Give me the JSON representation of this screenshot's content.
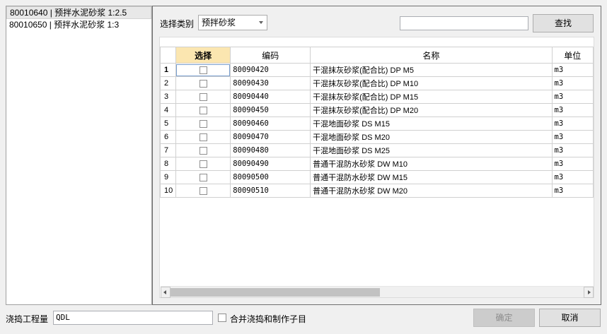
{
  "left_list": [
    {
      "label": "80010640 | 预拌水泥砂浆 1:2.5",
      "selected": true
    },
    {
      "label": "80010650 | 预拌水泥砂浆 1:3",
      "selected": false
    }
  ],
  "filter": {
    "category_label": "选择类别",
    "category_value": "预拌砂浆",
    "search_value": "",
    "search_button": "查找"
  },
  "table": {
    "headers": {
      "select": "选择",
      "code": "编码",
      "name": "名称",
      "unit": "单位"
    },
    "rows": [
      {
        "num": "1",
        "checked": false,
        "code": "80090420",
        "name": "干混抹灰砂浆(配合比) DP M5",
        "unit": "m3"
      },
      {
        "num": "2",
        "checked": false,
        "code": "80090430",
        "name": "干混抹灰砂浆(配合比) DP M10",
        "unit": "m3"
      },
      {
        "num": "3",
        "checked": false,
        "code": "80090440",
        "name": "干混抹灰砂浆(配合比) DP M15",
        "unit": "m3"
      },
      {
        "num": "4",
        "checked": false,
        "code": "80090450",
        "name": "干混抹灰砂浆(配合比) DP M20",
        "unit": "m3"
      },
      {
        "num": "5",
        "checked": false,
        "code": "80090460",
        "name": "干混地面砂浆 DS M15",
        "unit": "m3"
      },
      {
        "num": "6",
        "checked": false,
        "code": "80090470",
        "name": "干混地面砂浆 DS M20",
        "unit": "m3"
      },
      {
        "num": "7",
        "checked": false,
        "code": "80090480",
        "name": "干混地面砂浆 DS M25",
        "unit": "m3"
      },
      {
        "num": "8",
        "checked": false,
        "code": "80090490",
        "name": "普通干混防水砂浆 DW M10",
        "unit": "m3"
      },
      {
        "num": "9",
        "checked": false,
        "code": "80090500",
        "name": "普通干混防水砂浆 DW M15",
        "unit": "m3"
      },
      {
        "num": "10",
        "checked": false,
        "code": "80090510",
        "name": "普通干混防水砂浆 DW M20",
        "unit": "m3"
      }
    ]
  },
  "bottom": {
    "qty_label": "浇捣工程量",
    "qty_value": "QDL",
    "merge_label": "合并浇捣和制作子目",
    "merge_checked": false,
    "ok_label": "确定",
    "cancel_label": "取消"
  }
}
